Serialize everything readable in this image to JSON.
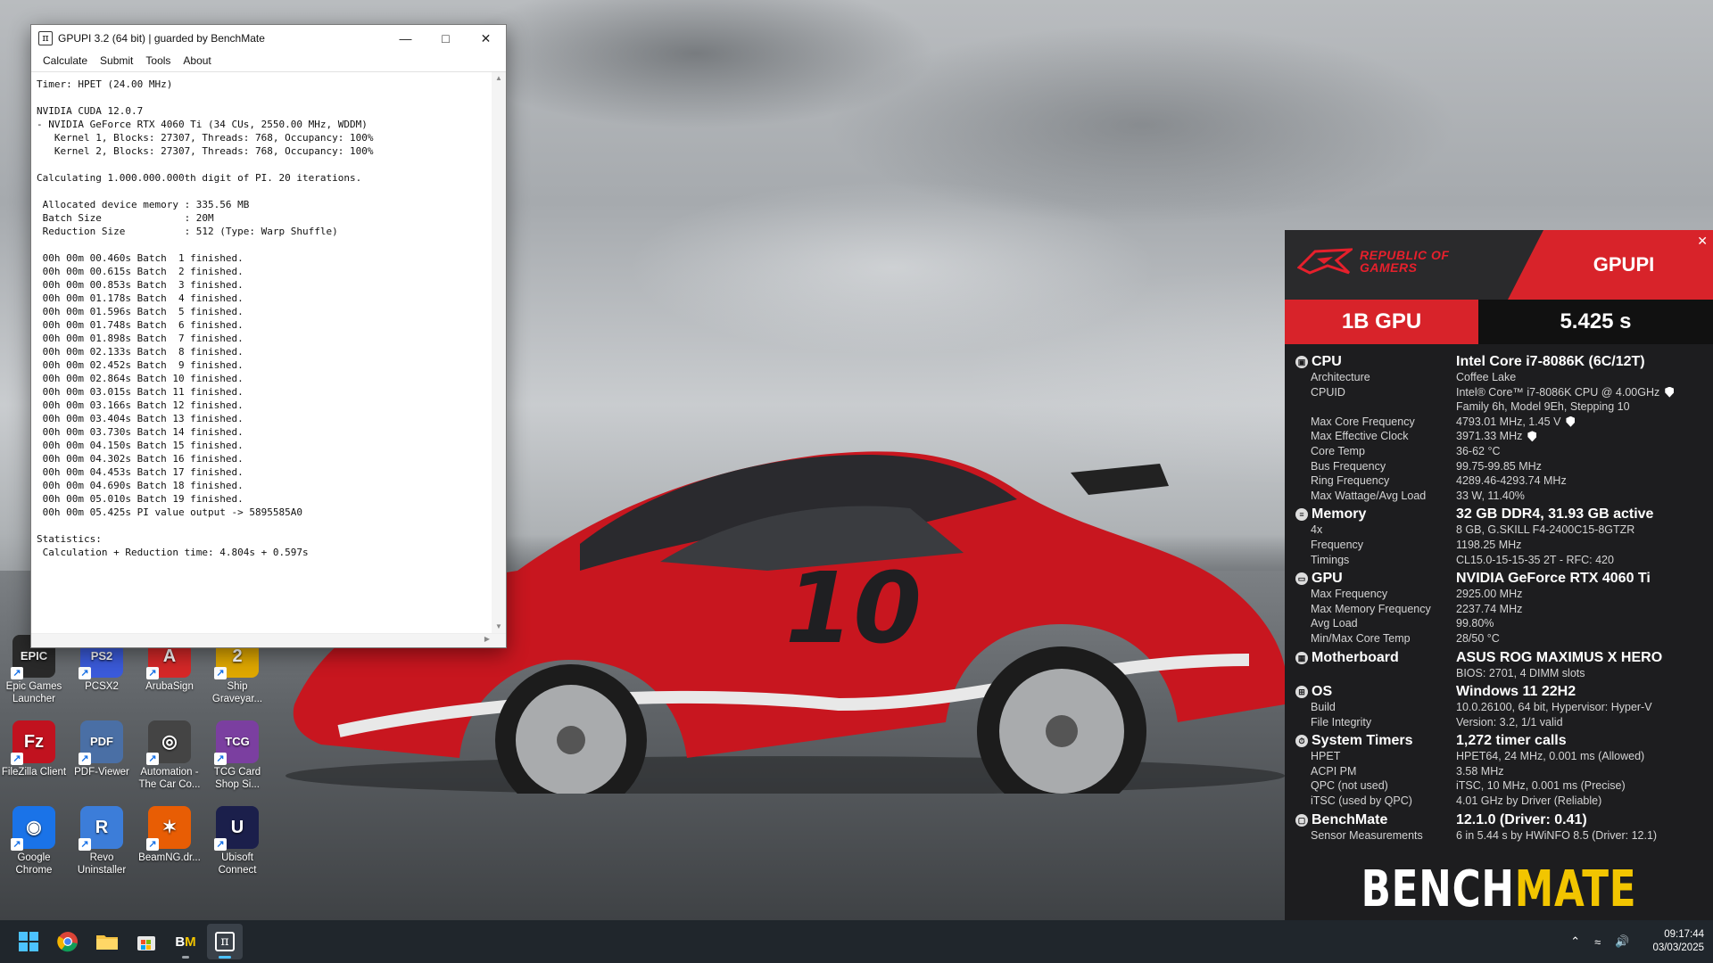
{
  "desktop": {
    "icons": [
      {
        "label": "Epic Games Launcher",
        "glyph": "EPIC",
        "color": "#2a2a2a"
      },
      {
        "label": "PCSX2",
        "glyph": "PS2",
        "color": "#3b5bdb"
      },
      {
        "label": "ArubaSign",
        "glyph": "A",
        "color": "#d62828"
      },
      {
        "label": "Ship Graveyar...",
        "glyph": "2",
        "color": "#e0a800"
      },
      {
        "label": "FileZilla Client",
        "glyph": "Fz",
        "color": "#c1121f"
      },
      {
        "label": "PDF-Viewer",
        "glyph": "PDF",
        "color": "#4a6fa5"
      },
      {
        "label": "Automation - The Car Co...",
        "glyph": "◎",
        "color": "#444"
      },
      {
        "label": "TCG Card Shop Si...",
        "glyph": "TCG",
        "color": "#7b3fa0"
      },
      {
        "label": "Google Chrome",
        "glyph": "◉",
        "color": "#1a73e8"
      },
      {
        "label": "Revo Uninstaller",
        "glyph": "R",
        "color": "#3c7dd9"
      },
      {
        "label": "BeamNG.dr...",
        "glyph": "✶",
        "color": "#e85d04"
      },
      {
        "label": "Ubisoft Connect",
        "glyph": "U",
        "color": "#1b1f4b"
      }
    ]
  },
  "window": {
    "title": "GPUPI 3.2 (64 bit) | guarded by BenchMate",
    "app_icon": "π",
    "menu": [
      "Calculate",
      "Submit",
      "Tools",
      "About"
    ],
    "console_lines": [
      "Timer: HPET (24.00 MHz)",
      "",
      "NVIDIA CUDA 12.0.7",
      "- NVIDIA GeForce RTX 4060 Ti (34 CUs, 2550.00 MHz, WDDM)",
      "   Kernel 1, Blocks: 27307, Threads: 768, Occupancy: 100%",
      "   Kernel 2, Blocks: 27307, Threads: 768, Occupancy: 100%",
      "",
      "Calculating 1.000.000.000th digit of PI. 20 iterations.",
      "",
      " Allocated device memory : 335.56 MB",
      " Batch Size              : 20M",
      " Reduction Size          : 512 (Type: Warp Shuffle)",
      "",
      " 00h 00m 00.460s Batch  1 finished.",
      " 00h 00m 00.615s Batch  2 finished.",
      " 00h 00m 00.853s Batch  3 finished.",
      " 00h 00m 01.178s Batch  4 finished.",
      " 00h 00m 01.596s Batch  5 finished.",
      " 00h 00m 01.748s Batch  6 finished.",
      " 00h 00m 01.898s Batch  7 finished.",
      " 00h 00m 02.133s Batch  8 finished.",
      " 00h 00m 02.452s Batch  9 finished.",
      " 00h 00m 02.864s Batch 10 finished.",
      " 00h 00m 03.015s Batch 11 finished.",
      " 00h 00m 03.166s Batch 12 finished.",
      " 00h 00m 03.404s Batch 13 finished.",
      " 00h 00m 03.730s Batch 14 finished.",
      " 00h 00m 04.150s Batch 15 finished.",
      " 00h 00m 04.302s Batch 16 finished.",
      " 00h 00m 04.453s Batch 17 finished.",
      " 00h 00m 04.690s Batch 18 finished.",
      " 00h 00m 05.010s Batch 19 finished.",
      " 00h 00m 05.425s PI value output -> 5895585A0",
      "",
      "Statistics:",
      " Calculation + Reduction time: 4.804s + 0.597s"
    ]
  },
  "benchmate": {
    "brand": "REPUBLIC OF GAMERS",
    "benchmark": "GPUPI",
    "score_label": "1B GPU",
    "score_value": "5.425 s",
    "sections": [
      {
        "name": "CPU",
        "icon": "cpu-icon",
        "value": "Intel Core i7-8086K (6C/12T)",
        "rows": [
          {
            "k": "Architecture",
            "v": "Coffee Lake",
            "shield": false
          },
          {
            "k": "CPUID",
            "v": "Intel® Core™ i7-8086K CPU @ 4.00GHz",
            "shield": true
          },
          {
            "k": "",
            "v": "Family 6h, Model 9Eh, Stepping 10",
            "shield": false
          },
          {
            "k": "Max Core Frequency",
            "v": "4793.01 MHz, 1.45 V",
            "shield": true
          },
          {
            "k": "Max Effective Clock",
            "v": "3971.33 MHz",
            "shield": true
          },
          {
            "k": "Core Temp",
            "v": "36-62 °C",
            "shield": false
          },
          {
            "k": "Bus Frequency",
            "v": "99.75-99.85 MHz",
            "shield": false
          },
          {
            "k": "Ring Frequency",
            "v": "4289.46-4293.74 MHz",
            "shield": false
          },
          {
            "k": "Max Wattage/Avg Load",
            "v": "33 W, 11.40%",
            "shield": false
          }
        ]
      },
      {
        "name": "Memory",
        "icon": "memory-icon",
        "value": "32 GB DDR4, 31.93 GB active",
        "rows": [
          {
            "k": "4x",
            "v": "8 GB, G.SKILL F4-2400C15-8GTZR",
            "shield": false
          },
          {
            "k": "Frequency",
            "v": "1198.25 MHz",
            "shield": false
          },
          {
            "k": "Timings",
            "v": "CL15.0-15-15-35 2T - RFC: 420",
            "shield": false
          }
        ]
      },
      {
        "name": "GPU",
        "icon": "gpu-icon",
        "value": "NVIDIA GeForce RTX 4060 Ti",
        "rows": [
          {
            "k": "Max Frequency",
            "v": "2925.00 MHz",
            "shield": false
          },
          {
            "k": "Max Memory Frequency",
            "v": "2237.74 MHz",
            "shield": false
          },
          {
            "k": "Avg Load",
            "v": "99.80%",
            "shield": false
          },
          {
            "k": "Min/Max Core Temp",
            "v": "28/50 °C",
            "shield": false
          }
        ]
      },
      {
        "name": "Motherboard",
        "icon": "motherboard-icon",
        "value": "ASUS ROG MAXIMUS X HERO",
        "rows": [
          {
            "k": "",
            "v": "BIOS: 2701, 4 DIMM slots",
            "shield": false
          }
        ]
      },
      {
        "name": "OS",
        "icon": "windows-icon",
        "value": "Windows 11 22H2",
        "rows": [
          {
            "k": "Build",
            "v": "10.0.26100, 64 bit, Hypervisor: Hyper-V",
            "shield": false
          },
          {
            "k": "File Integrity",
            "v": "Version: 3.2, 1/1 valid",
            "shield": false
          }
        ]
      },
      {
        "name": "System Timers",
        "icon": "timer-icon",
        "value": "1,272 timer calls",
        "rows": [
          {
            "k": "HPET",
            "v": "HPET64, 24 MHz, 0.001 ms (Allowed)",
            "shield": false
          },
          {
            "k": "ACPI PM",
            "v": "3.58 MHz",
            "shield": false
          },
          {
            "k": "QPC (not used)",
            "v": "iTSC, 10 MHz, 0.001 ms (Precise)",
            "shield": false
          },
          {
            "k": "iTSC (used by QPC)",
            "v": "4.01 GHz by Driver (Reliable)",
            "shield": false
          }
        ]
      },
      {
        "name": "BenchMate",
        "icon": "benchmate-icon",
        "value": "12.1.0 (Driver: 0.41)",
        "rows": [
          {
            "k": "Sensor Measurements",
            "v": "6 in 5.44 s by HWiNFO 8.5 (Driver: 12.1)",
            "shield": false
          }
        ]
      }
    ],
    "logo_a": "BENCH",
    "logo_b": "MATE"
  },
  "taskbar": {
    "time": "09:17:44",
    "date": "03/03/2025"
  }
}
